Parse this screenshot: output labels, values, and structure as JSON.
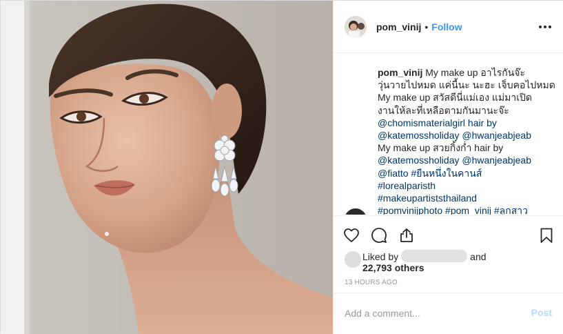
{
  "post": {
    "image_alt": "Portrait photo of a woman wearing a diamond flower drop earring",
    "username": "pom_vinij",
    "separator": "•",
    "follow_label": "Follow",
    "more_icon": "more-options-icon"
  },
  "caption": {
    "username": "pom_vinij",
    "lines": [
      "My make up อาไรกันจ๊ะ",
      "วุ่นวายไปหมด แค่นี้นะ นะฮะ เจ็บคอไปหมด",
      "My make up สวัสดีนี่แม่เอง แม่มาเปิด",
      "งานให้ละที่เหลือตามกันมานะจ๊ะ",
      "@chomismaterialgirl hair by",
      "@katemossholiday @hwanjeabjeab",
      "My make up สวยกิ้งก่ำ hair by",
      "@katemossholiday @hwanjeabjeab",
      "@fiatto #ยืนหนึ่งในคานส์",
      "#lorealparisth",
      "#makeupartiststhailand",
      "#pomvinijphoto #pom_vinij #ลูกสาว"
    ]
  },
  "actions": {
    "like_icon": "heart-icon",
    "comment_icon": "comment-icon",
    "share_icon": "share-icon",
    "save_icon": "bookmark-icon"
  },
  "likes": {
    "liked_by": "Liked by",
    "and": "and",
    "others": "22,793 others"
  },
  "timestamp": "13 HOURS AGO",
  "comment_box": {
    "placeholder": "Add a comment...",
    "post_label": "Post"
  },
  "colors": {
    "accent": "#3897f0",
    "post_disabled": "#b3dbff",
    "hashtag": "#003569",
    "muted": "#999999",
    "text": "#262626"
  }
}
